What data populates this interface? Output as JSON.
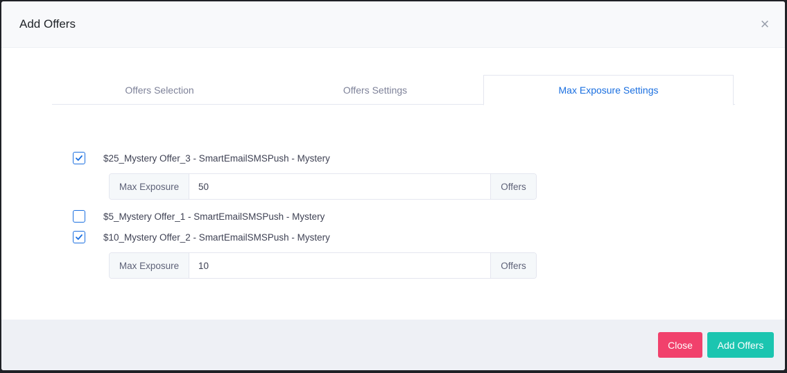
{
  "modal": {
    "title": "Add Offers",
    "close_glyph": "×"
  },
  "tabs": [
    {
      "label": "Offers Selection",
      "active": false
    },
    {
      "label": "Offers Settings",
      "active": false
    },
    {
      "label": "Max Exposure Settings",
      "active": true
    }
  ],
  "offers": [
    {
      "label": "$25_Mystery Offer_3 - SmartEmailSMSPush - Mystery",
      "checked": true,
      "max_exposure": "50"
    },
    {
      "label": "$5_Mystery Offer_1 - SmartEmailSMSPush - Mystery",
      "checked": false
    },
    {
      "label": "$10_Mystery Offer_2 - SmartEmailSMSPush - Mystery",
      "checked": true,
      "max_exposure": "10"
    }
  ],
  "input_group": {
    "prefix": "Max Exposure",
    "suffix": "Offers"
  },
  "footer": {
    "close_label": "Close",
    "add_label": "Add Offers"
  },
  "colors": {
    "accent": "#1a6fe0",
    "close_button": "#f1416c",
    "add_button": "#1bc5b0"
  },
  "icons": {
    "dismiss": "close-icon",
    "check": "checkmark-icon"
  }
}
